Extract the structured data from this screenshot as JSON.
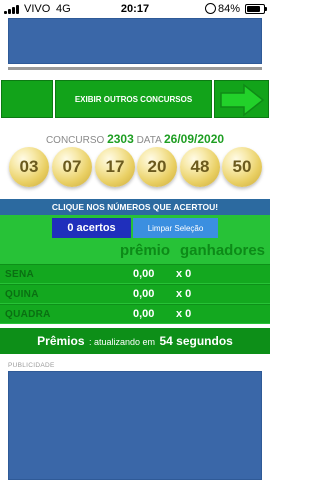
{
  "status_bar": {
    "carrier": "VIVO",
    "network": "4G",
    "time": "20:17",
    "battery": "84%",
    "battery_level": 0.84
  },
  "nav": {
    "other_contests_label": "EXIBIR OUTROS CONCURSOS"
  },
  "contest": {
    "label": "CONCURSO",
    "number": "2303",
    "date_label": "DATA",
    "date": "26/09/2020"
  },
  "balls": [
    "03",
    "07",
    "17",
    "20",
    "48",
    "50"
  ],
  "select_prompt": "CLIQUE NOS NÚMEROS QUE ACERTOU!",
  "acertos": {
    "count_label": "0 acertos",
    "clear_label": "Limpar Seleção"
  },
  "results": {
    "header_prize": "prêmio",
    "header_winners": "ganhadores",
    "rows": [
      {
        "label": "SENA",
        "prize": "0,00",
        "winners": "x 0"
      },
      {
        "label": "QUINA",
        "prize": "0,00",
        "winners": "x 0"
      },
      {
        "label": "QUADRA",
        "prize": "0,00",
        "winners": "x 0"
      }
    ]
  },
  "premios": {
    "bold": "Prêmios",
    "text": ": atualizando em",
    "seconds": "54 segundos"
  },
  "publicidade_label": "PUBLICIDADE",
  "colors": {
    "green": "#12a31a",
    "ball_gold": "#e9cf63",
    "blue_banner": "#2c6aa0",
    "ad_blue": "#3a67a8"
  }
}
